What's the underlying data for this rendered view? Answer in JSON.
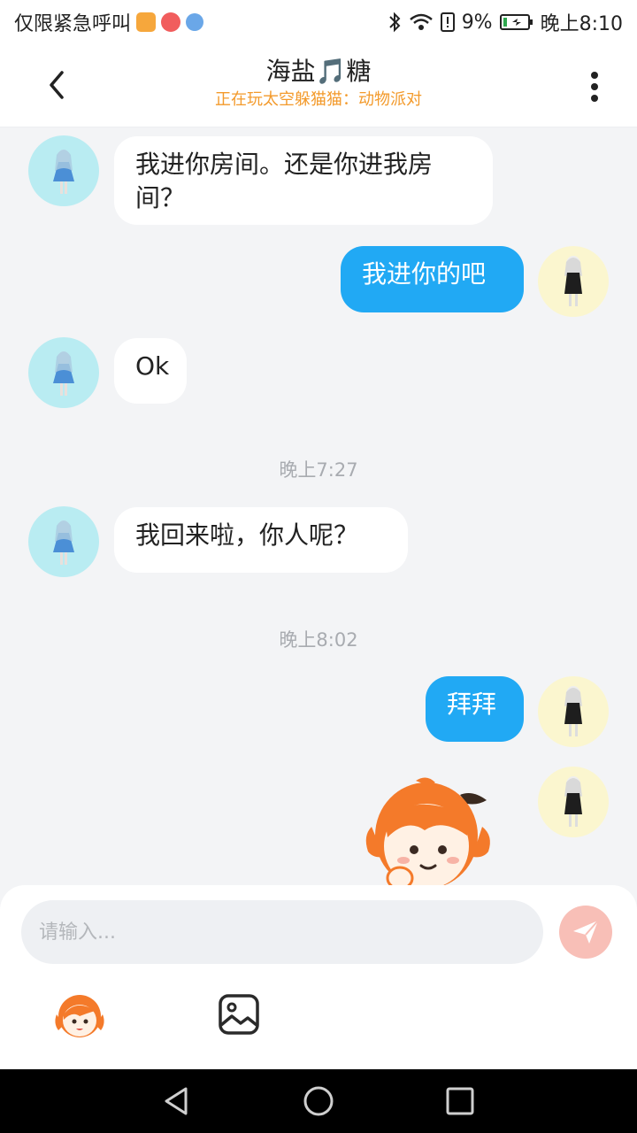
{
  "status_bar": {
    "carrier": "仅限紧急呼叫",
    "battery": "9%",
    "time": "晚上8:10"
  },
  "header": {
    "title": "海盐🎵糖",
    "subtitle": "正在玩太空躲猫猫：动物派对"
  },
  "messages": {
    "m1_line1": "我进你房间。还是你进我房",
    "m1_line2": "间？",
    "m2": "我进你的吧",
    "m3": "Ok",
    "time1": "晚上7:27",
    "m4": "我回来啦，你人呢？",
    "time2": "晚上8:02",
    "m5": "拜拜"
  },
  "composer": {
    "placeholder": "请输入..."
  },
  "colors": {
    "accent_blue": "#21a9f4",
    "subtitle_orange": "#f39a2b",
    "send_button": "#f8bfb7"
  },
  "icons": [
    "back-arrow-icon",
    "more-vert-icon",
    "send-icon",
    "emoji-icon",
    "image-icon",
    "nav-back-icon",
    "nav-home-icon",
    "nav-recents-icon"
  ]
}
